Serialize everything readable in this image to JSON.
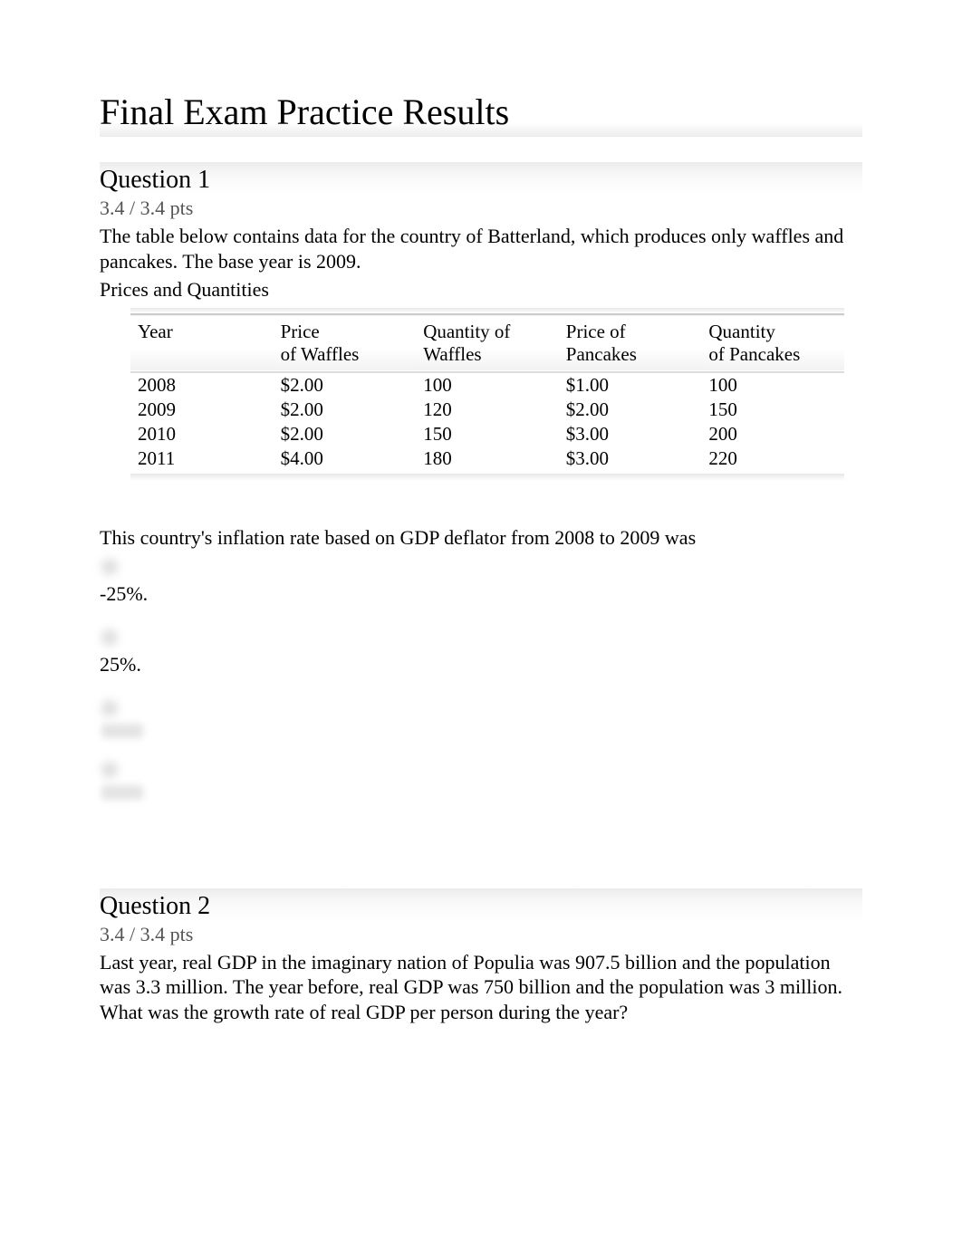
{
  "page_title": "Final Exam Practice Results",
  "q1": {
    "heading": "Question 1",
    "points": "3.4 / 3.4 pts",
    "intro": "The table below contains data for the country of Batterland, which produces only waffles and pancakes. The base year is 2009.",
    "table_title": "Prices and Quantities",
    "headers": {
      "c1": "Year",
      "c2a": "Price",
      "c2b": "of Waffles",
      "c3a": "Quantity of",
      "c3b": "Waffles",
      "c4a": "Price of",
      "c4b": "Pancakes",
      "c5a": "Quantity",
      "c5b": "of Pancakes"
    },
    "rows": [
      {
        "year": "2008",
        "pw": "$2.00",
        "qw": "100",
        "pp": "$1.00",
        "qp": "100"
      },
      {
        "year": "2009",
        "pw": "$2.00",
        "qw": "120",
        "pp": "$2.00",
        "qp": "150"
      },
      {
        "year": "2010",
        "pw": "$2.00",
        "qw": "150",
        "pp": "$3.00",
        "qp": "200"
      },
      {
        "year": "2011",
        "pw": "$4.00",
        "qw": "180",
        "pp": "$3.00",
        "qp": "220"
      }
    ],
    "stem": "This country's inflation rate based on GDP deflator from 2008 to 2009 was",
    "options": {
      "a": "-25%.",
      "b": "25%."
    }
  },
  "q2": {
    "heading": "Question 2",
    "points": "3.4 / 3.4 pts",
    "text": "Last year, real GDP in the imaginary nation of Populia was 907.5 billion and the population was 3.3 million. The year before, real GDP was 750 billion and the population was 3 million. What was the growth rate of real GDP per person during the year?"
  }
}
